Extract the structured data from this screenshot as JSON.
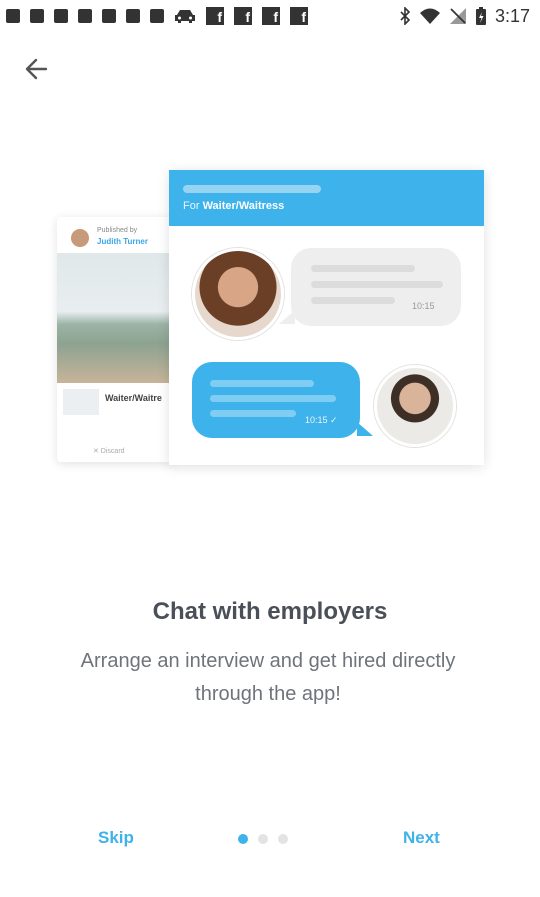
{
  "status_bar": {
    "time": "3:17",
    "fb_glyph": "f",
    "icons": [
      "notification-icon",
      "notification-icon",
      "notification-icon",
      "notification-icon",
      "notification-icon",
      "notification-icon",
      "notification-icon",
      "car-icon",
      "facebook-icon",
      "facebook-icon",
      "facebook-icon",
      "facebook-icon",
      "bluetooth-icon",
      "wifi-icon",
      "no-signal-icon",
      "battery-icon"
    ]
  },
  "nav": {
    "back_icon": "arrow-left-icon"
  },
  "illustration": {
    "published_by": "Published by",
    "publisher_name": "Judith Turner",
    "job_role": "Waiter/Waitre",
    "discard_label": "✕ Discard",
    "header_for": "For ",
    "header_role": "Waiter/Waitress",
    "bubble_time_1": "10:15",
    "bubble_time_2": "10:15 ✓"
  },
  "onboarding": {
    "title": "Chat with employers",
    "subtitle": "Arrange an interview and get hired directly through the app!",
    "skip_label": "Skip",
    "next_label": "Next",
    "page_count": 3,
    "active_page": 1
  },
  "colors": {
    "accent": "#3eb2ea",
    "title": "#4a4f58",
    "subtitle": "#6f747a"
  }
}
